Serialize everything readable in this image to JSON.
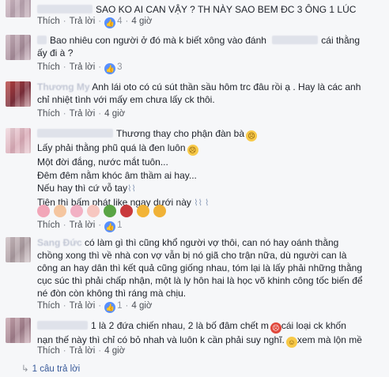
{
  "labels": {
    "like": "Thích",
    "reply": "Trả lời",
    "sep": "·",
    "like_badge": "👍"
  },
  "comments": [
    {
      "lines": [
        "SAO KO AI CAN VẬY ? TH NÀY SAO BEM ĐC 3 ÔNG 1 LÚC"
      ],
      "time": "4 giờ",
      "likes": "4",
      "name": ""
    },
    {
      "lines": [
        "Bao nhiêu con người ở đó mà k biết xông vào đánh",
        "cái thằng",
        "ấy đi à ?"
      ],
      "time": "",
      "likes": "3",
      "name": ""
    },
    {
      "lines": [
        "Anh lái oto có cú sút thần sầu hôm trc đâu rồi ạ . Hay là các anh",
        "chỉ nhiệt tình với mấy em chưa lấy ck thôi."
      ],
      "time": "4 giờ",
      "likes": "",
      "name": "Thương My"
    },
    {
      "lines": [
        "Thương thay cho phận đàn bà",
        "Lấy phải thằng phũ quá là đen luôn",
        "Một đời đắng, nước mắt tuôn...",
        "Đêm đêm nằm khóc âm thầm ai hay...",
        "Nếu hay thì cứ vỗ tay",
        "Tiện thì bấm phát like ngay dưới này"
      ],
      "time": "",
      "likes": "1",
      "name": ""
    },
    {
      "lines": [
        "có làm gì thì cũng khổ người vợ thôi, can nó hay oánh thằng",
        "chồng xong thì về nhà con vợ vẫn bị nó giã cho trận nữa, dù người can là",
        "công an hay dân thì kết quả cũng giống nhau, tóm lại là lấy phải những thằng",
        "cục súc thì phải chấp nhận, một là ly hôn hai là học võ khinh công tốc biến để",
        "né đòn còn không thì ráng mà chịu."
      ],
      "time": "4 giờ",
      "likes": "1",
      "name": "Sang Đức"
    },
    {
      "lines": [
        "1 là 2 đứa chiến nhau, 2 là bố đâm chết m",
        "cái loại ck khốn",
        "nạn thế này thì chỉ có bỏ nhah và luôn k cần phải suy nghĩ.",
        "xem mà lộn mề"
      ],
      "time": "4 giờ",
      "likes": "",
      "name": ""
    }
  ],
  "reply_count": "1 câu trả lời"
}
